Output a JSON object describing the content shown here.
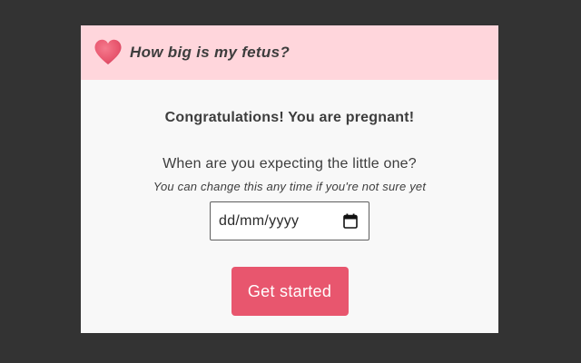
{
  "header": {
    "icon": "heart-icon",
    "title": "How big is my fetus?"
  },
  "main": {
    "congrats": "Congratulations! You are pregnant!",
    "question": "When are you expecting the little one?",
    "hint": "You can change this any time if you're not sure yet",
    "due_date": {
      "placeholder": "dd/mm/yyyy",
      "value": "",
      "icon": "calendar-icon"
    },
    "cta_label": "Get started"
  },
  "colors": {
    "page_background": "#333333",
    "header_background": "#ffd6dc",
    "panel_background": "#f8f8f8",
    "accent": "#e8566e",
    "heart": "#e8566e",
    "text": "#3d3d3d"
  }
}
